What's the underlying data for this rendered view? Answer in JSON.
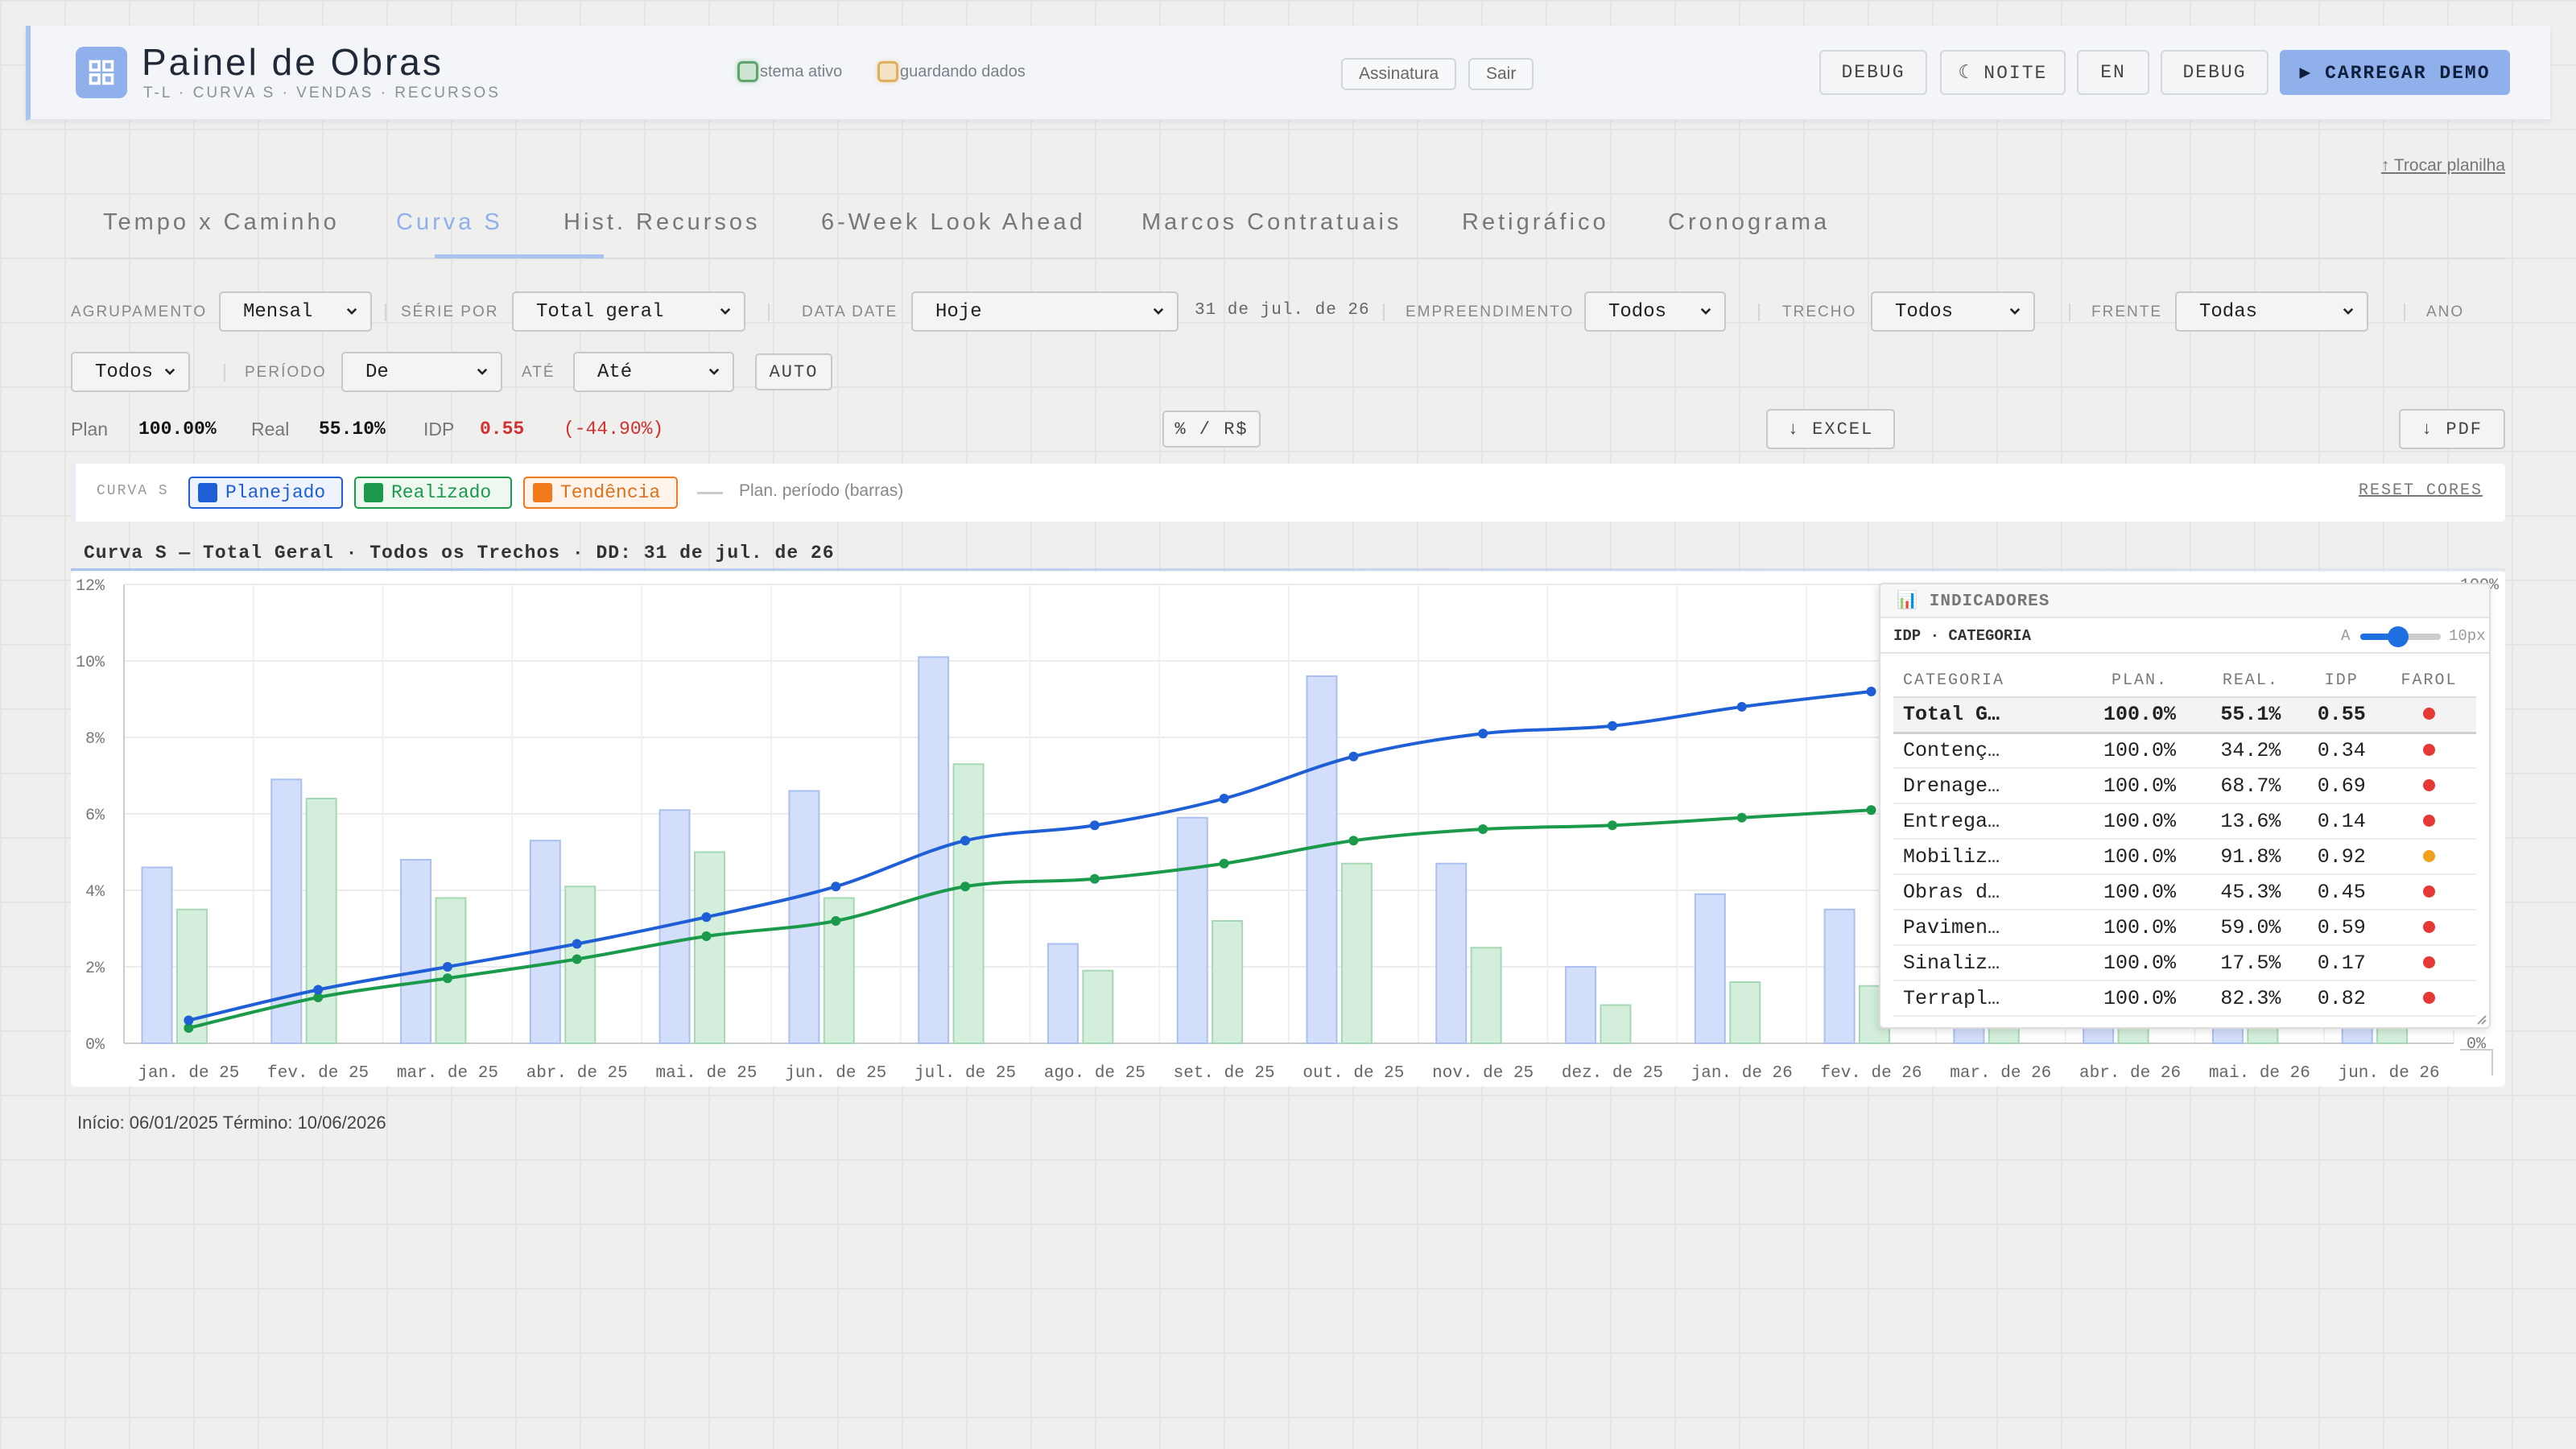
{
  "header": {
    "title": "Painel de Obras",
    "subtitle": "T-L · CURVA S · VENDAS · RECURSOS",
    "status_active": "stema ativo",
    "status_saving": "guardando dados",
    "signature_label": "Assinatura",
    "logout_label": "Sair",
    "debug_label": "DEBUG",
    "night_label": "☾ NOITE",
    "lang_label": "EN",
    "debug2_label": "DEBUG",
    "demo_label": "▶ CARREGAR DEMO"
  },
  "swap_sheet": "↑ Trocar planilha",
  "tabs": [
    "Tempo x Caminho",
    "Curva S",
    "Hist. Recursos",
    "6-Week Look Ahead",
    "Marcos Contratuais",
    "Retigráfico",
    "Cronograma"
  ],
  "active_tab": "Curva S",
  "filters": {
    "agrupamento_label": "AGRUPAMENTO",
    "agrupamento_value": "Mensal",
    "serie_label": "SÉRIE POR",
    "serie_value": "Total geral",
    "datadate_label": "DATA DATE",
    "datadate_value": "Hoje",
    "datadate_text": "31 de jul. de 26",
    "empreendimento_label": "EMPREENDIMENTO",
    "empreendimento_value": "Todos",
    "trecho_label": "TRECHO",
    "trecho_value": "Todos",
    "frente_label": "FRENTE",
    "frente_value": "Todas",
    "ano_label": "ANO",
    "ano_value": "Todos",
    "periodo_label": "PERÍODO",
    "periodo_value": "De",
    "ate_label": "ATÉ",
    "ate_value": "Até",
    "auto_label": "AUTO"
  },
  "kpis": {
    "plan_label": "Plan",
    "plan_value": "100.00%",
    "real_label": "Real",
    "real_value": "55.10%",
    "idp_label": "IDP",
    "idp_value": "0.55",
    "idp_delta": "(-44.90%)"
  },
  "actions": {
    "toggle_label": "% / R$",
    "excel_label": "↓ EXCEL",
    "pdf_label": "↓ PDF"
  },
  "legend": {
    "label": "CURVA S",
    "planned": "Planejado",
    "actual": "Realizado",
    "trend": "Tendência",
    "bars_note": "Plan. período (barras)",
    "reset": "RESET CORES",
    "colors": {
      "planned": "#1f5fd6",
      "actual": "#1a9a4a",
      "trend": "#f07a1c"
    }
  },
  "chart_title": "Curva S — Total Geral · Todos os Trechos · DD: 31 de jul. de 26",
  "chart_data": {
    "type": "bar",
    "categories": [
      "jan. de 25",
      "fev. de 25",
      "mar. de 25",
      "abr. de 25",
      "mai. de 25",
      "jun. de 25",
      "jul. de 25",
      "ago. de 25",
      "set. de 25",
      "out. de 25",
      "nov. de 25",
      "dez. de 25",
      "jan. de 26",
      "fev. de 26",
      "mar. de 26",
      "abr. de 26",
      "mai. de 26",
      "jun. de 26"
    ],
    "ylim": [
      0,
      12
    ],
    "yticks": [
      "0%",
      "2%",
      "4%",
      "6%",
      "8%",
      "10%",
      "12%"
    ],
    "y2_labels": [
      "0%",
      "100%"
    ],
    "series": [
      {
        "name": "Plan. período (barras)",
        "type": "bar",
        "values": [
          4.6,
          6.9,
          4.8,
          5.3,
          6.1,
          6.6,
          10.1,
          2.6,
          5.9,
          9.6,
          4.7,
          2.0,
          3.9,
          3.5,
          2.0,
          2.0,
          2.0,
          2.0
        ]
      },
      {
        "name": "Realizado",
        "type": "bar",
        "values": [
          3.5,
          6.4,
          3.8,
          4.1,
          5.0,
          3.8,
          7.3,
          1.9,
          3.2,
          4.7,
          2.5,
          1.0,
          1.6,
          1.5,
          1.0,
          1.0,
          1.0,
          1.0
        ]
      },
      {
        "name": "Planejado",
        "type": "line",
        "values": [
          0.6,
          1.4,
          2.0,
          2.6,
          3.3,
          4.1,
          5.3,
          5.7,
          6.4,
          7.5,
          8.1,
          8.3,
          8.8,
          9.2,
          null,
          null,
          null,
          null
        ]
      },
      {
        "name": "Realizado",
        "type": "line",
        "values": [
          0.4,
          1.2,
          1.7,
          2.2,
          2.8,
          3.2,
          4.1,
          4.3,
          4.7,
          5.3,
          5.6,
          5.7,
          5.9,
          6.1,
          null,
          null,
          null,
          null
        ]
      }
    ]
  },
  "footer": "Início: 06/01/2025 Término: 10/06/2026",
  "indicators": {
    "title": "📊 INDICADORES",
    "subtitle": "IDP · CATEGORIA",
    "font_a": "A",
    "font_size": "10px",
    "columns": [
      "CATEGORIA",
      "PLAN.",
      "REAL.",
      "IDP",
      "FAROL"
    ],
    "rows": [
      {
        "cat": "Total G…",
        "plan": "100.0%",
        "real": "55.1%",
        "idp": "0.55",
        "farol": "#e53935",
        "total": true
      },
      {
        "cat": "Contenç…",
        "plan": "100.0%",
        "real": "34.2%",
        "idp": "0.34",
        "farol": "#e53935"
      },
      {
        "cat": "Drenage…",
        "plan": "100.0%",
        "real": "68.7%",
        "idp": "0.69",
        "farol": "#e53935"
      },
      {
        "cat": "Entrega…",
        "plan": "100.0%",
        "real": "13.6%",
        "idp": "0.14",
        "farol": "#e53935"
      },
      {
        "cat": "Mobiliz…",
        "plan": "100.0%",
        "real": "91.8%",
        "idp": "0.92",
        "farol": "#f2a01f"
      },
      {
        "cat": "Obras d…",
        "plan": "100.0%",
        "real": "45.3%",
        "idp": "0.45",
        "farol": "#e53935"
      },
      {
        "cat": "Pavimen…",
        "plan": "100.0%",
        "real": "59.0%",
        "idp": "0.59",
        "farol": "#e53935"
      },
      {
        "cat": "Sinaliz…",
        "plan": "100.0%",
        "real": "17.5%",
        "idp": "0.17",
        "farol": "#e53935"
      },
      {
        "cat": "Terrapl…",
        "plan": "100.0%",
        "real": "82.3%",
        "idp": "0.82",
        "farol": "#e53935"
      }
    ]
  }
}
